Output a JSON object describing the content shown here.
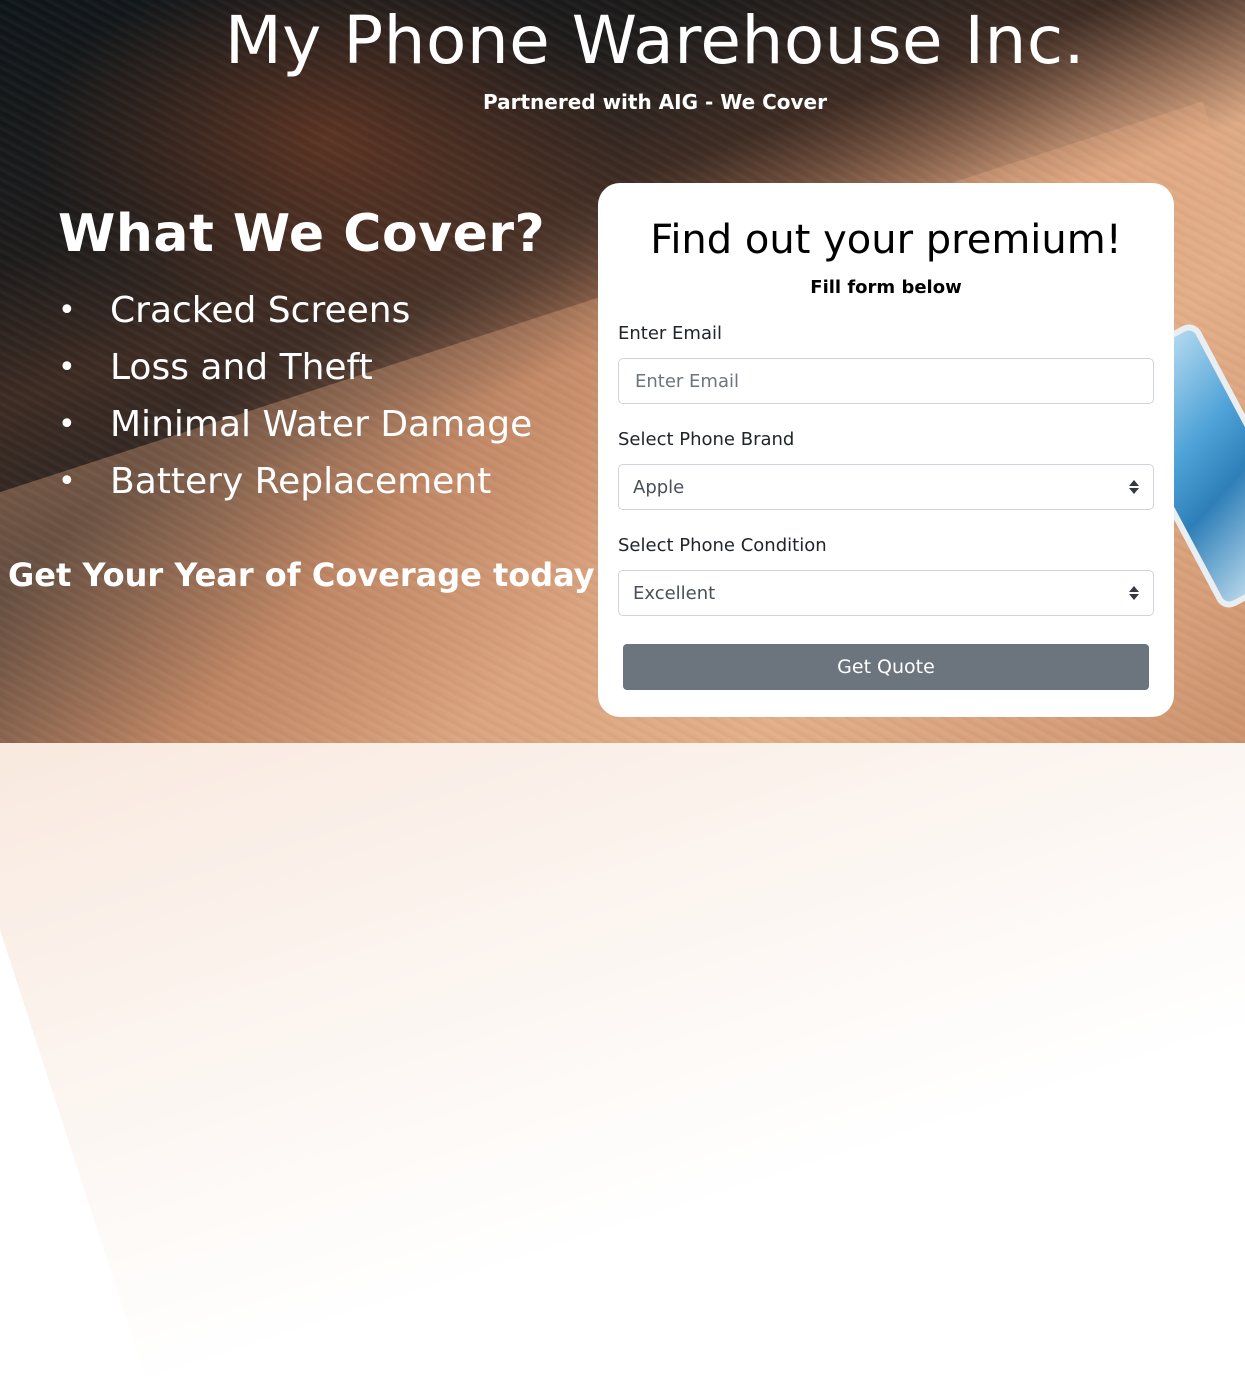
{
  "header": {
    "title": "My Phone Warehouse Inc.",
    "subtitle": "Partnered with AIG - We Cover"
  },
  "coverage": {
    "title": "What We Cover?",
    "items": [
      {
        "label": "Cracked Screens"
      },
      {
        "label": "Loss and Theft"
      },
      {
        "label": "Minimal Water Damage"
      },
      {
        "label": "Battery Replacement"
      }
    ],
    "bullet": "•",
    "cta": "Get Your Year of Coverage today ✓"
  },
  "form": {
    "title": "Find out your premium!",
    "subtitle": "Fill form below",
    "email": {
      "label": "Enter Email",
      "placeholder": "Enter Email",
      "value": ""
    },
    "brand": {
      "label": "Select Phone Brand",
      "selected": "Apple"
    },
    "condition": {
      "label": "Select Phone Condition",
      "selected": "Excellent"
    },
    "submit_label": "Get Quote"
  },
  "colors": {
    "button": "#6c757d",
    "card": "#ffffff",
    "text_light": "#ffffff"
  }
}
